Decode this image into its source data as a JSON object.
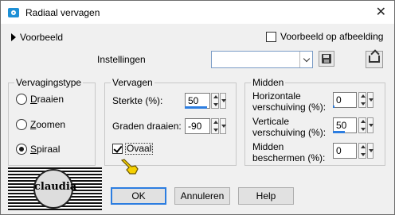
{
  "window": {
    "title": "Radiaal vervagen",
    "close_glyph": "✕"
  },
  "preview": {
    "label": "Voorbeeld",
    "on_image_label": "Voorbeeld op afbeelding",
    "on_image_checked": false
  },
  "settings": {
    "label": "Instellingen",
    "preset_value": ""
  },
  "blur_type": {
    "title": "Vervagingstype",
    "options": [
      {
        "label": "Draaien",
        "selected": false
      },
      {
        "label": "Zoomen",
        "selected": false
      },
      {
        "label": "Spiraal",
        "selected": true
      }
    ]
  },
  "logo": {
    "text": "claudia"
  },
  "blur": {
    "title": "Vervagen",
    "strength_label": "Sterkte (%):",
    "strength_value": "50",
    "twist_label": "Graden draaien:",
    "twist_value": "-90",
    "elliptical_label": "Ovaal",
    "elliptical_checked": true
  },
  "center": {
    "title": "Midden",
    "h_offset_label_1": "Horizontale",
    "h_offset_label_2": "verschuiving (%):",
    "h_offset_value": "0",
    "v_offset_label_1": "Verticale",
    "v_offset_label_2": "verschuiving (%):",
    "v_offset_value": "50",
    "protect_label_1": "Midden",
    "protect_label_2": "beschermen (%):",
    "protect_value": "0"
  },
  "buttons": {
    "ok": "OK",
    "cancel": "Annuleren",
    "help": "Help"
  },
  "colors": {
    "accent": "#2c7de0",
    "icon_blue": "#1e90d6",
    "pointer_yellow": "#f5d000"
  },
  "icons": [
    "camera-icon",
    "close-icon",
    "expand-triangle-icon",
    "chevron-down-icon",
    "save-preset-icon",
    "reset-icon",
    "pointing-hand-icon"
  ]
}
